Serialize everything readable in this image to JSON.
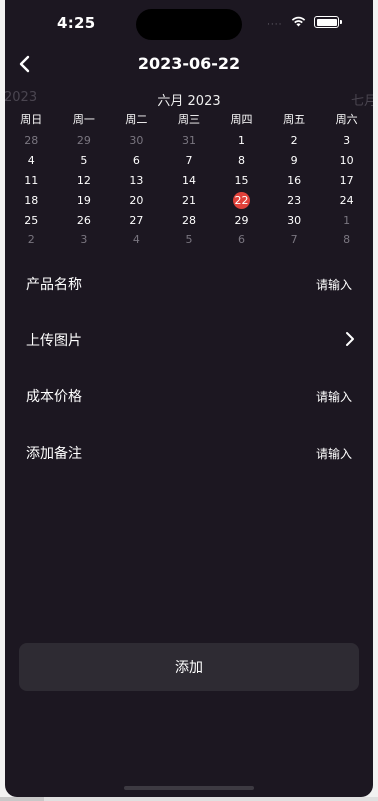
{
  "status_bar": {
    "time": "4:25",
    "dots": "····"
  },
  "nav": {
    "title": "2023-06-22"
  },
  "calendar": {
    "prev_label": "2023",
    "month_label": "六月 2023",
    "next_label": "七月",
    "weekdays": [
      "周日",
      "周一",
      "周二",
      "周三",
      "周四",
      "周五",
      "周六"
    ],
    "weeks": [
      [
        {
          "d": "28",
          "m": true
        },
        {
          "d": "29",
          "m": true
        },
        {
          "d": "30",
          "m": true
        },
        {
          "d": "31",
          "m": true
        },
        {
          "d": "1"
        },
        {
          "d": "2"
        },
        {
          "d": "3"
        }
      ],
      [
        {
          "d": "4"
        },
        {
          "d": "5"
        },
        {
          "d": "6"
        },
        {
          "d": "7"
        },
        {
          "d": "8"
        },
        {
          "d": "9"
        },
        {
          "d": "10"
        }
      ],
      [
        {
          "d": "11"
        },
        {
          "d": "12"
        },
        {
          "d": "13"
        },
        {
          "d": "14"
        },
        {
          "d": "15"
        },
        {
          "d": "16"
        },
        {
          "d": "17"
        }
      ],
      [
        {
          "d": "18"
        },
        {
          "d": "19"
        },
        {
          "d": "20"
        },
        {
          "d": "21"
        },
        {
          "d": "22",
          "sel": true
        },
        {
          "d": "23"
        },
        {
          "d": "24"
        }
      ],
      [
        {
          "d": "25"
        },
        {
          "d": "26"
        },
        {
          "d": "27"
        },
        {
          "d": "28"
        },
        {
          "d": "29"
        },
        {
          "d": "30"
        },
        {
          "d": "1",
          "m": true
        }
      ],
      [
        {
          "d": "2",
          "m": true
        },
        {
          "d": "3",
          "m": true
        },
        {
          "d": "4",
          "m": true
        },
        {
          "d": "5",
          "m": true
        },
        {
          "d": "6",
          "m": true
        },
        {
          "d": "7",
          "m": true
        },
        {
          "d": "8",
          "m": true
        }
      ]
    ],
    "selected_color": "#e0413a"
  },
  "form": {
    "product_name": {
      "label": "产品名称",
      "value": "请输入"
    },
    "upload_image": {
      "label": "上传图片"
    },
    "cost_price": {
      "label": "成本价格",
      "value": "请输入"
    },
    "note": {
      "label": "添加备注",
      "value": "请输入"
    }
  },
  "add_button": {
    "label": "添加"
  },
  "colors": {
    "background": "#1c1721",
    "button": "#2e2b33"
  }
}
